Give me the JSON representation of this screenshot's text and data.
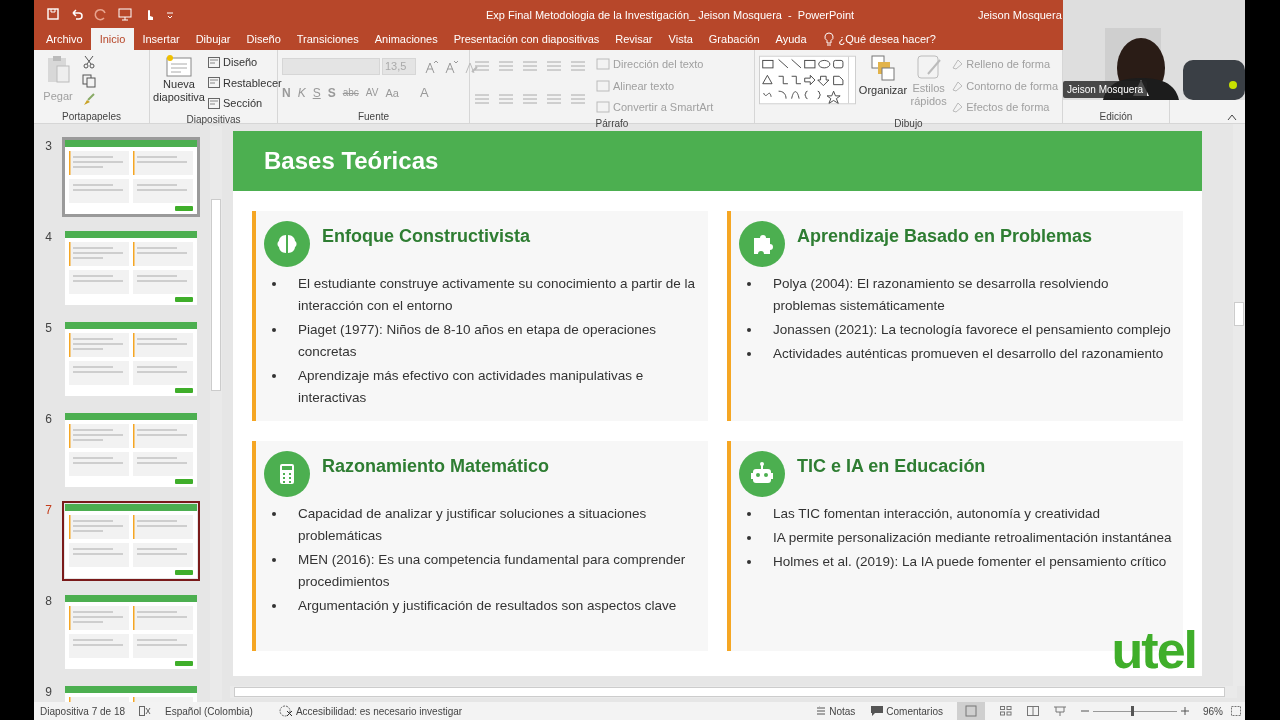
{
  "title_bar": {
    "title": "Exp Final Metodologia de la Investigación_ Jeison Mosquera  -  PowerPoint",
    "user": "Jeison Mosquera"
  },
  "tabs": [
    {
      "label": "Archivo",
      "selected": false
    },
    {
      "label": "Inicio",
      "selected": true
    },
    {
      "label": "Insertar",
      "selected": false
    },
    {
      "label": "Dibujar",
      "selected": false
    },
    {
      "label": "Diseño",
      "selected": false
    },
    {
      "label": "Transiciones",
      "selected": false
    },
    {
      "label": "Animaciones",
      "selected": false
    },
    {
      "label": "Presentación con diapositivas",
      "selected": false
    },
    {
      "label": "Revisar",
      "selected": false
    },
    {
      "label": "Vista",
      "selected": false
    },
    {
      "label": "Grabación",
      "selected": false
    },
    {
      "label": "Ayuda",
      "selected": false
    }
  ],
  "tell_me": "¿Qué desea hacer?",
  "ribbon": {
    "clipboard": {
      "label": "Portapapeles",
      "paste": {
        "label": "Pegar",
        "disabled": true
      }
    },
    "slides": {
      "label": "Diapositivas",
      "new_slide": "Nueva diapositiva",
      "commands": [
        "Diseño",
        "Restablecer",
        "Sección"
      ]
    },
    "font": {
      "label": "Fuente",
      "size": "13,5",
      "buttons": [
        "N",
        "K",
        "S",
        "S",
        "abc",
        "AV",
        "Aa",
        "A"
      ]
    },
    "paragraph": {
      "label": "Párrafo",
      "commands": [
        {
          "label": "Dirección del texto",
          "disabled": true
        },
        {
          "label": "Alinear texto",
          "disabled": true
        },
        {
          "label": "Convertir a SmartArt",
          "disabled": true
        }
      ]
    },
    "drawing": {
      "label": "Dibujo",
      "arrange": "Organizar",
      "quick_styles": {
        "label": "Estilos rápidos",
        "disabled": true
      },
      "commands": [
        {
          "label": "Relleno de forma",
          "disabled": true
        },
        {
          "label": "Contorno de forma",
          "disabled": true
        },
        {
          "label": "Efectos de forma",
          "disabled": true
        }
      ]
    },
    "editing": {
      "label": "Edición"
    }
  },
  "camera": {
    "label": "Jeison Mosquera"
  },
  "thumbnails": [
    {
      "number": "3",
      "selected": false,
      "hovered": true
    },
    {
      "number": "4",
      "selected": false,
      "hovered": false
    },
    {
      "number": "5",
      "selected": false,
      "hovered": false
    },
    {
      "number": "6",
      "selected": false,
      "hovered": false
    },
    {
      "number": "7",
      "selected": true,
      "hovered": false
    },
    {
      "number": "8",
      "selected": false,
      "hovered": false
    },
    {
      "number": "9",
      "selected": false,
      "hovered": false
    }
  ],
  "slide": {
    "title": "Bases Teóricas",
    "logo": "utel",
    "cards": [
      {
        "title": "Enfoque Constructivista",
        "bullets": [
          "El estudiante construye activamente su conocimiento a partir de la interacción con el entorno",
          "Piaget (1977): Niños de 8-10 años en etapa de operaciones concretas",
          "Aprendizaje más efectivo con actividades manipulativas e interactivas"
        ]
      },
      {
        "title": "Aprendizaje Basado en Problemas",
        "bullets": [
          "Polya (2004): El razonamiento se desarrolla resolviendo problemas sistemáticamente",
          "Jonassen (2021): La tecnología favorece el pensamiento complejo",
          "Actividades auténticas promueven el desarrollo del razonamiento"
        ]
      },
      {
        "title": "Razonamiento Matemático",
        "bullets": [
          "Capacidad de analizar y justificar soluciones a situaciones problemáticas",
          "MEN (2016): Es una competencia fundamental para comprender procedimientos",
          "Argumentación y justificación de resultados son aspectos clave"
        ]
      },
      {
        "title": "TIC e IA en Educación",
        "bullets": [
          "Las TIC fomentan interacción, autonomía y creatividad",
          "IA permite personalización mediante retroalimentación instantánea",
          "Holmes et al. (2019): La IA puede fomenter el pensamiento crítico"
        ]
      }
    ]
  },
  "status_bar": {
    "slide_info": "Diapositiva 7 de 18",
    "language": "Español (Colombia)",
    "accessibility": "Accesibilidad: es necesario investigar",
    "notes": "Notas",
    "comments": "Comentarios",
    "zoom": {
      "level": 0.47,
      "reading": "96%"
    }
  }
}
